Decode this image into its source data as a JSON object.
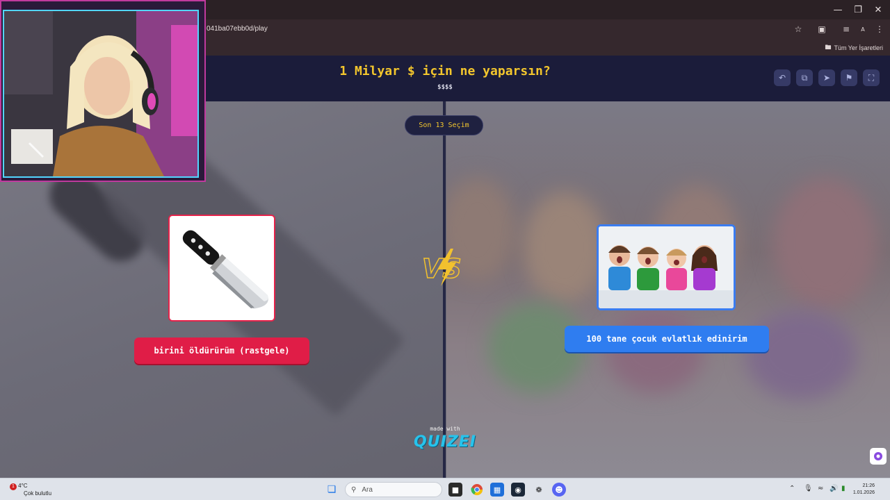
{
  "browser": {
    "url_fragment": "041ba07ebb0d/play",
    "bookmarks_label": "Tüm Yer İşaretleri",
    "profile_initial": "A",
    "window_controls": [
      "minimize",
      "restore",
      "close"
    ]
  },
  "quiz": {
    "title": "1 Milyar $ için ne yaparsın?",
    "subtitle": "$$$$",
    "recent_label": "Son 13 Seçim",
    "vs_label": "VS",
    "header_icons": [
      "undo-icon",
      "share-icon",
      "send-icon",
      "flag-icon",
      "fullscreen-icon"
    ],
    "options": [
      {
        "label": "birini öldürürüm (rastgele)",
        "image": "knife-image",
        "color": "#e01d47"
      },
      {
        "label": "100 tane çocuk evlatlık edinirim",
        "image": "children-image",
        "color": "#2f7df0"
      }
    ],
    "footer": {
      "made_with": "made with",
      "brand": "QUIZEI"
    }
  },
  "taskbar": {
    "weather_temp": "4°C",
    "weather_desc": "Çok bulutlu",
    "weather_badge": "1",
    "search_placeholder": "Ara",
    "time": "21:26",
    "date": "1.01.2026",
    "apps": [
      "windows-start-icon",
      "search-icon",
      "file-explorer-icon",
      "chrome-icon",
      "microsoft-store-icon",
      "steam-icon",
      "app-icon",
      "discord-icon"
    ]
  }
}
